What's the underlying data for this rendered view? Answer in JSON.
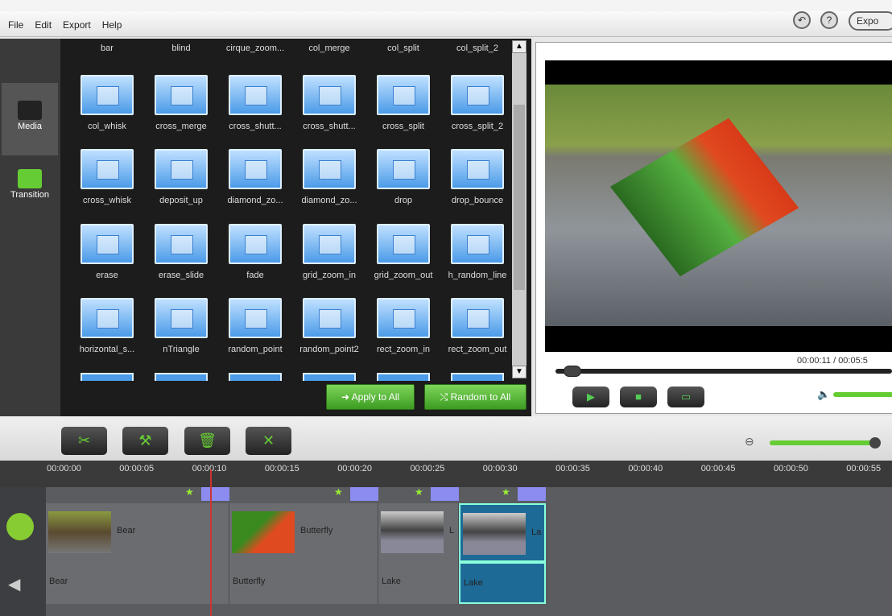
{
  "menu": [
    "File",
    "Edit",
    "Export",
    "Help"
  ],
  "export_label": "Expo",
  "nav": {
    "media": "Media",
    "transition": "Transition"
  },
  "transitions": [
    [
      "bar",
      "blind",
      "cirque_zoom...",
      "col_merge",
      "col_split",
      "col_split_2"
    ],
    [
      "col_whisk",
      "cross_merge",
      "cross_shutt...",
      "cross_shutt...",
      "cross_split",
      "cross_split_2"
    ],
    [
      "cross_whisk",
      "deposit_up",
      "diamond_zo...",
      "diamond_zo...",
      "drop",
      "drop_bounce"
    ],
    [
      "erase",
      "erase_slide",
      "fade",
      "grid_zoom_in",
      "grid_zoom_out",
      "h_random_line"
    ],
    [
      "horizontal_s...",
      "nTriangle",
      "random_point",
      "random_point2",
      "rect_zoom_in",
      "rect_zoom_out"
    ]
  ],
  "buttons": {
    "apply_all": "➜ Apply to All",
    "random_all": "⤭ Random to All"
  },
  "player": {
    "current": "00:00:11",
    "total": "00:05:5",
    "progress": 0.03,
    "volume": 0.85
  },
  "timeline": {
    "ticks": [
      "00:00:00",
      "00:00:05",
      "00:00:10",
      "00:00:15",
      "00:00:20",
      "00:00:25",
      "00:00:30",
      "00:00:35",
      "00:00:40",
      "00:00:45",
      "00:00:50",
      "00:00:55"
    ],
    "zoom": 0.97,
    "video_clips": [
      "Bear",
      "Butterfly",
      "L",
      "La"
    ],
    "audio_clips": [
      "Bear",
      "Butterfly",
      "Lake",
      "Lake"
    ]
  },
  "colors": {
    "accent": "#66cc33",
    "selected": "#1e6a96",
    "transition": "#8c8cf0",
    "playhead": "#cc3333"
  }
}
